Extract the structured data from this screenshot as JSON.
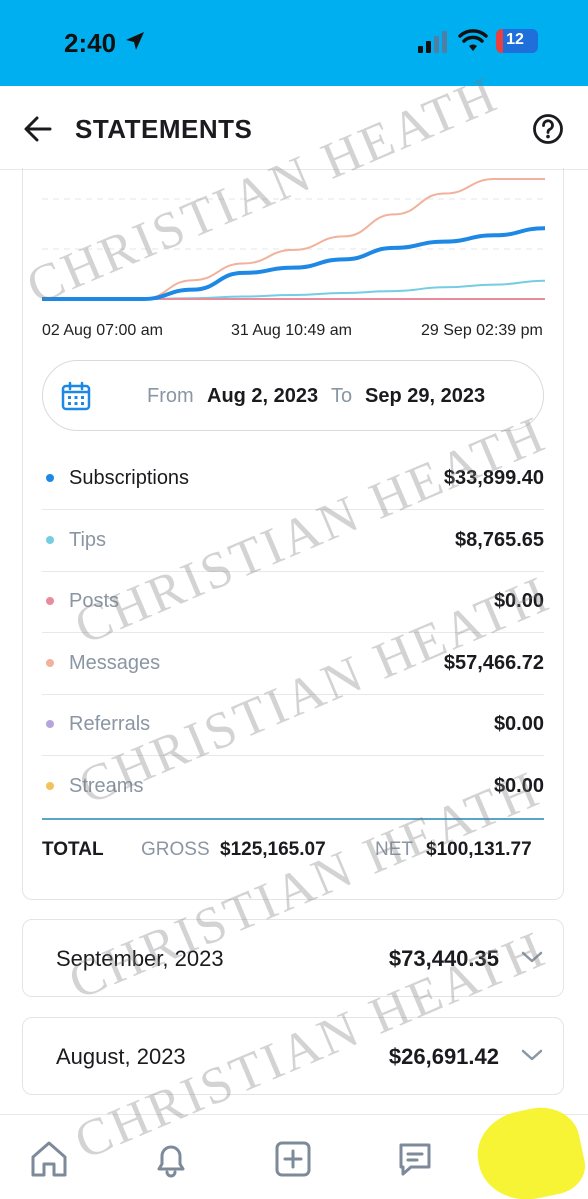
{
  "status_bar": {
    "time": "2:40",
    "battery": "12"
  },
  "header": {
    "title": "STATEMENTS",
    "back_icon": "arrow-left-icon",
    "help_icon": "question-circle-icon"
  },
  "chart_data": {
    "type": "line",
    "title": "",
    "xlabel": "",
    "ylabel": "",
    "x_tick_labels": [
      "02 Aug 07:00 am",
      "31 Aug 10:49 am",
      "29 Sep 02:39 pm"
    ],
    "x": [
      0,
      0.1,
      0.2,
      0.3,
      0.4,
      0.5,
      0.6,
      0.7,
      0.8,
      0.9,
      1.0
    ],
    "x_unit_note": "",
    "grid": true,
    "series": [
      {
        "name": "Subscriptions",
        "color": "#1e88e5",
        "values": [
          0,
          0,
          0,
          4500,
          12500,
          15000,
          19000,
          24500,
          27500,
          30500,
          33899.4
        ]
      },
      {
        "name": "Tips",
        "color": "#74cde2",
        "values": [
          0,
          0,
          0,
          350,
          1200,
          1900,
          2900,
          3800,
          5600,
          6900,
          8765.65
        ]
      },
      {
        "name": "Posts",
        "color": "#e98b9a",
        "values": [
          0,
          0,
          0,
          0,
          0,
          0,
          0,
          0,
          0,
          0,
          0
        ]
      },
      {
        "name": "Messages",
        "color": "#f2b19b",
        "values": [
          0,
          0,
          0,
          9000,
          17000,
          23500,
          30000,
          40500,
          50500,
          57466.72,
          57466.72
        ]
      }
    ]
  },
  "date_range": {
    "from_label": "From",
    "from_value": "Aug 2, 2023",
    "to_label": "To",
    "to_value": "Sep 29, 2023"
  },
  "categories": [
    {
      "label": "Subscriptions",
      "amount": "$33,899.40",
      "color": "#1e88e5"
    },
    {
      "label": "Tips",
      "amount": "$8,765.65",
      "color": "#74cde2"
    },
    {
      "label": "Posts",
      "amount": "$0.00",
      "color": "#e98b9a"
    },
    {
      "label": "Messages",
      "amount": "$57,466.72",
      "color": "#f2b19b"
    },
    {
      "label": "Referrals",
      "amount": "$0.00",
      "color": "#b7a4dc"
    },
    {
      "label": "Streams",
      "amount": "$0.00",
      "color": "#f5c15c"
    }
  ],
  "totals": {
    "total_label": "TOTAL",
    "gross_label": "GROSS",
    "gross_value": "$125,165.07",
    "net_label": "NET",
    "net_value": "$100,131.77"
  },
  "months": [
    {
      "name": "September, 2023",
      "amount": "$73,440.35"
    },
    {
      "name": "August, 2023",
      "amount": "$26,691.42"
    }
  ],
  "watermark_text": "CHRISTIAN HEATH",
  "bottom_nav": [
    "home-icon",
    "bell-icon",
    "plus-square-icon",
    "chat-icon",
    "profile-avatar"
  ],
  "colors": {
    "status_bar": "#00aff0",
    "accent_blue": "#1e88e5",
    "muted_text": "#8a96a3"
  }
}
